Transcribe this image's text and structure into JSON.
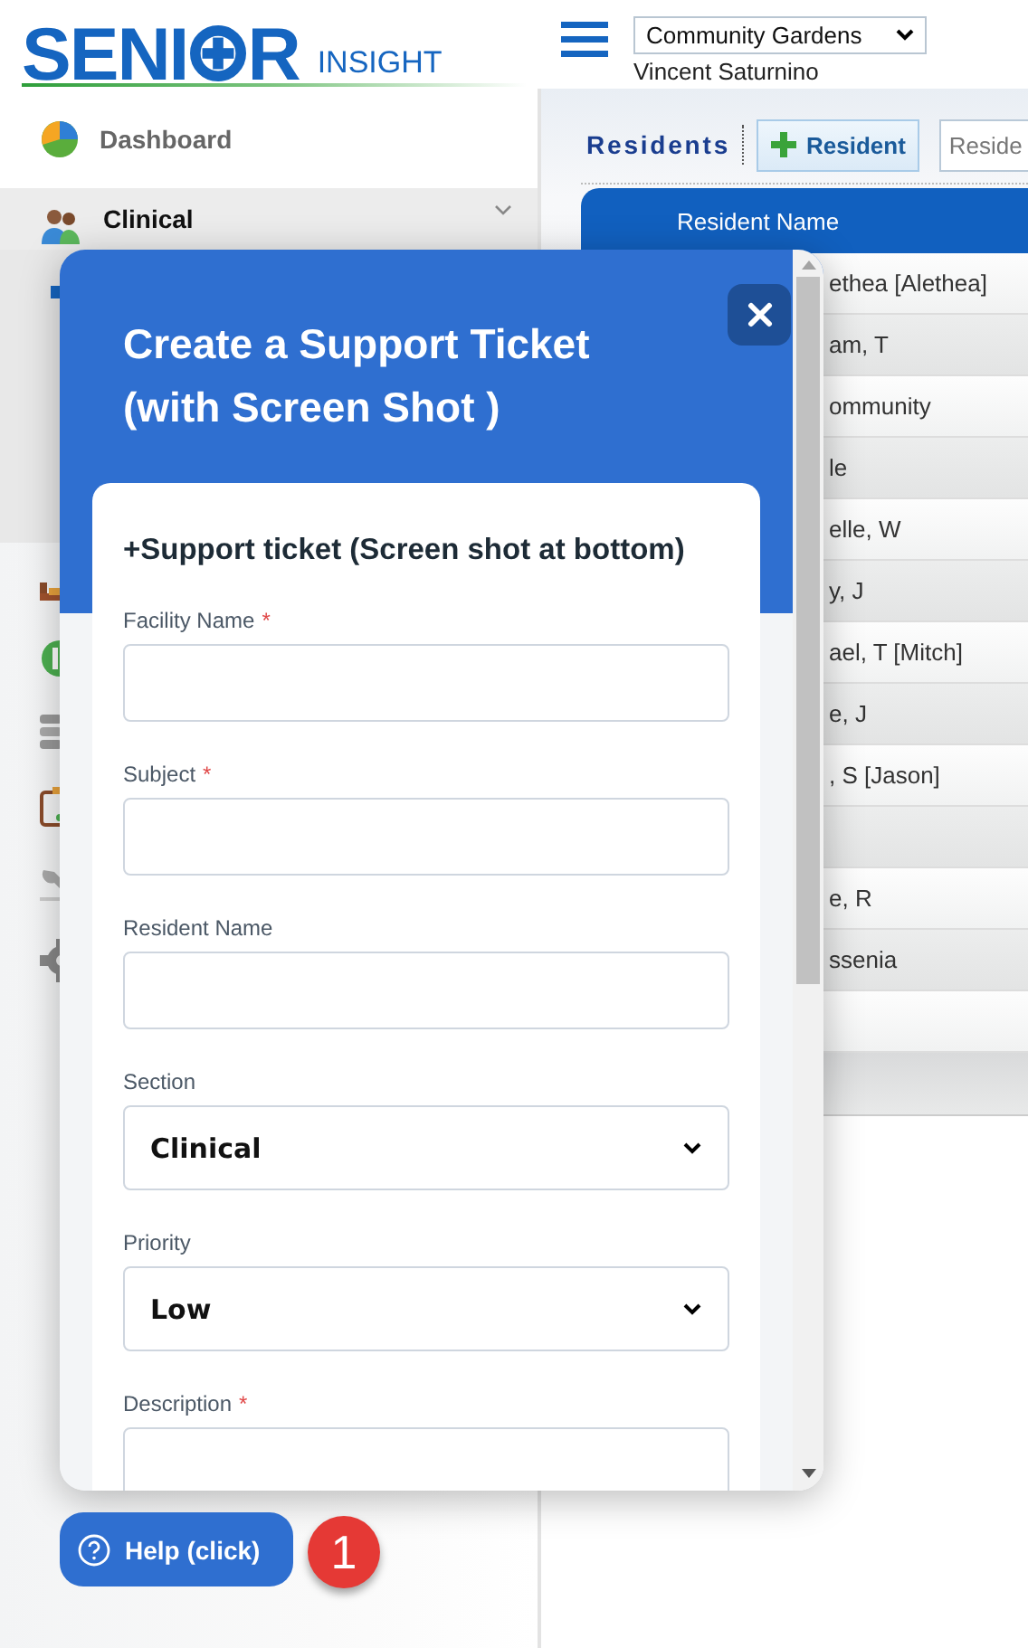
{
  "header": {
    "logo": {
      "word_start": "SENI",
      "word_end": "R",
      "tagline": "INSIGHT"
    },
    "facility_select": {
      "value": "Community Gardens"
    },
    "user_name": "Vincent Saturnino"
  },
  "sidebar": {
    "items": [
      {
        "label": "Dashboard",
        "selected": false,
        "expanded": false
      },
      {
        "label": "Clinical",
        "selected": true,
        "expanded": true
      }
    ]
  },
  "residents": {
    "title": "Residents",
    "add_button": "Resident",
    "search": {
      "placeholder": "Reside"
    },
    "table": {
      "columns": [
        "Resident Name"
      ],
      "rows": [
        {
          "resident_name": "ethea [Alethea]"
        },
        {
          "resident_name": "am, T"
        },
        {
          "resident_name": "ommunity"
        },
        {
          "resident_name": "le"
        },
        {
          "resident_name": "elle, W"
        },
        {
          "resident_name": "y, J"
        },
        {
          "resident_name": "ael, T [Mitch]"
        },
        {
          "resident_name": "e, J"
        },
        {
          "resident_name": ", S [Jason]"
        },
        {},
        {
          "resident_name": "e, R"
        },
        {
          "resident_name": "ssenia"
        },
        {}
      ]
    }
  },
  "modal": {
    "title": "Create a Support Ticket (with Screen Shot )",
    "form": {
      "heading": "+Support ticket (Screen shot at bottom)",
      "fields": [
        {
          "kind": "text",
          "label": "Facility Name",
          "required_mark": "*"
        },
        {
          "kind": "text",
          "label": "Subject",
          "required_mark": "*"
        },
        {
          "kind": "text",
          "label": "Resident Name"
        },
        {
          "kind": "select",
          "label": "Section",
          "value": "Clinical"
        },
        {
          "kind": "select",
          "label": "Priority",
          "value": "Low"
        },
        {
          "kind": "text",
          "label": "Description",
          "required_mark": "*"
        }
      ]
    }
  },
  "help_button": {
    "label": "Help (click)"
  },
  "badge": {
    "count": "1"
  }
}
